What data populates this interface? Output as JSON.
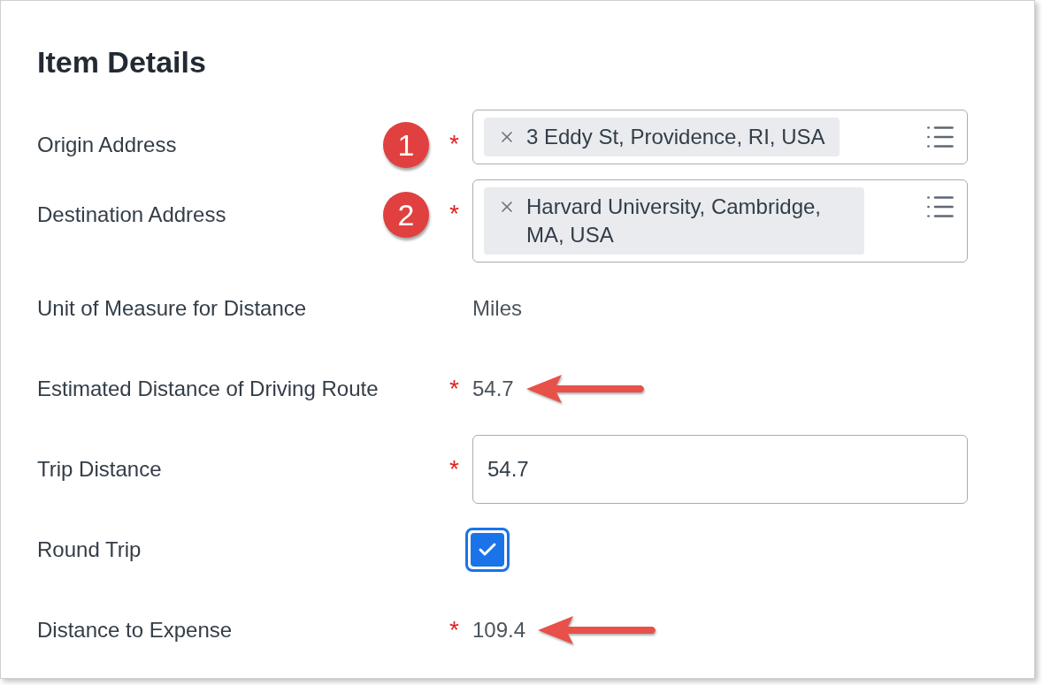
{
  "title": "Item Details",
  "rows": [
    {
      "kind": "address",
      "label": "Origin Address",
      "asterisk": "*",
      "callout": "1",
      "value": "3 Eddy St, Providence, RI, USA"
    },
    {
      "kind": "address",
      "label": "Destination Address",
      "asterisk": "*",
      "callout": "2",
      "value": "Harvard University, Cambridge, MA, USA"
    },
    {
      "kind": "text",
      "label": "Unit of Measure for Distance",
      "value": "Miles"
    },
    {
      "kind": "text",
      "label": "Estimated Distance of Driving Route",
      "asterisk": "*",
      "value": "54.7",
      "arrow": true
    },
    {
      "kind": "input",
      "label": "Trip Distance",
      "asterisk": "*",
      "value": "54.7"
    },
    {
      "kind": "checkbox",
      "label": "Round Trip",
      "checked": true
    },
    {
      "kind": "text",
      "label": "Distance to Expense",
      "asterisk": "*",
      "value": "109.4",
      "arrow": true
    }
  ]
}
